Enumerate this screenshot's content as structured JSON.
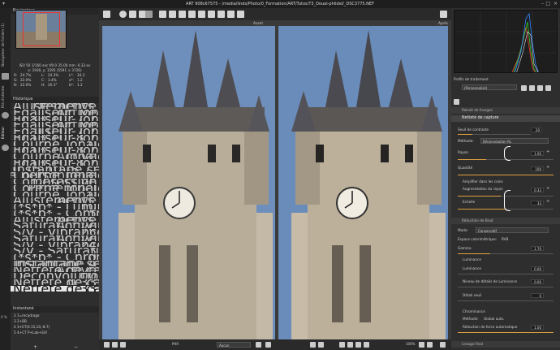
{
  "window": {
    "title": "ART 908c67575 - /media/linds/Photo/0_Formation/ART/Tutos/T3_Douai-phildel/_DSC3775.NEF"
  },
  "left_tabs": [
    "Navigateur de fichiers (1)",
    "File d'attente",
    "Éditeur"
  ],
  "navigator": {
    "title": "Navigateur",
    "info_line1": "ISO 50   1/160 sec  f/9.0  35.00 mm  -0.33 ev",
    "info_line2": "x: 1930, y: 1595  (5591 × 3726)",
    "rgb_rows": [
      [
        "R:",
        "24.7%",
        "L:",
        "24.3%",
        "L*:",
        "34.3"
      ],
      [
        "G:",
        "22.0%",
        "C:",
        "3.4%",
        "a*:",
        "1.2"
      ],
      [
        "B:",
        "22.0%",
        "H:",
        "20.3°",
        "b*:",
        "1.2"
      ]
    ]
  },
  "history": {
    "title": "Historique",
    "rows": [
      [
        "Ajustements (*s*b*",
        "Désactivé"
      ],
      [
        "Égaliseur Tonal",
        "Activé"
      ],
      [
        "Égaliseur Tonal - Ba...",
        "0 33 10 -7 7"
      ],
      [
        "Égaliseur Tonal",
        "Activé"
      ],
      [
        "Égaliseur Tonal - Ba...",
        "0 0 0 -7 7"
      ],
      [
        "Égaliseur Tonal - Ba...",
        "0 13 10 -8 7"
      ],
      [
        "Courbe Tonale - Com...",
        "0"
      ],
      [
        "Égaliseur Tonal - Ba...",
        "0 13 10 -8 7"
      ],
      [
        "Courbe Tonale - Com...",
        "Activé"
      ],
      [
        "Égaliseur Tonal - Ba...",
        "0 13 10 -8 7"
      ],
      [
        "Instantané sélection...",
        "4 3+ET(0.15,10,-8.7)"
      ],
      [
        "Courbe Tonale - Com...",
        "Courbe personnelle"
      ],
      [
        "Compression de la P...",
        "Désactivé"
      ],
      [
        "Courbe Tonale - Mode",
        "Perceptuel"
      ],
      [
        "Courbe Tonale - Com...",
        "0"
      ],
      [
        "Ajustements (*s*b*",
        "Activé"
      ],
      [
        "(*s*b* - Luminosité",
        "10"
      ],
      [
        "(*s*b* - Contraste",
        "15"
      ],
      [
        "Ajustements (*s*b*",
        "Activé"
      ],
      [
        "Saturation/Vibrance",
        "Activé"
      ],
      [
        "S/V - Vibrance",
        "25"
      ],
      [
        "Saturation/Vibrance",
        "Activé"
      ],
      [
        "S/V - Vibrance",
        "24"
      ],
      [
        "S/V - Saturation",
        "3"
      ],
      [
        "(*s*b* - Chromaticité",
        "10"
      ],
      [
        "Instantané sélection...",
        "Instantané 4"
      ],
      [
        "Netteté de capture",
        "Activé"
      ],
      [
        "Déconvolution (RL) -...",
        "1.00"
      ],
      [
        "Netteté de capture -...",
        "0.33"
      ],
      [
        "Netteté de capture -...",
        "33"
      ]
    ],
    "selected_index": 29
  },
  "snapshots": {
    "title": "Instantané",
    "items": [
      "2  1=recadrage",
      "3  2+BB",
      "4  3+ET(0.15,10,-8.7)",
      "5  4+CT P+Lab+S/V"
    ]
  },
  "viewer": {
    "left_label": "Avant",
    "right_label": "Après",
    "bottom_profile": "Aucun",
    "bottom_mode": "PHR",
    "zoom": "100%"
  },
  "right_panel": {
    "profile_title": "Profils de traitement",
    "profile_value": "(Personnalisé)",
    "sections": {
      "noise_prev": "Retrait de franges",
      "capture": "Netteté de capture",
      "noise": "Réduction de Bruit",
      "final": "Lissage final"
    },
    "capture": {
      "contrast_label": "Seuil de contraste",
      "contrast_value": "20",
      "method_label": "Méthode:",
      "method_value": "Déconvolution RL",
      "radius_label": "Rayon",
      "radius_value": "1.00",
      "amount_label": "Quantité",
      "amount_value": "100",
      "corners_label": "Amplifier dans les coins",
      "radius_boost_label": "Augmentation du rayon",
      "radius_boost_value": "0.33",
      "scale_label": "Echelle",
      "scale_value": "33",
      "radius_fill": 0.3,
      "amount_fill": 1.0,
      "radius_boost_fill": 0.45,
      "scale_fill": 0.5
    },
    "noise": {
      "mode_label": "Mode:",
      "mode_value": "Conservatif",
      "color_space_label": "Espace colorimétrique:",
      "color_space_value": "RVB",
      "gamma_label": "Gamma",
      "gamma_value": "1.70",
      "luminance_label": "Luminance",
      "luminance_sub": "Luminance",
      "luminance_value": "0.00",
      "detail_label": "Niveau de détails de Luminance",
      "detail_value": "0.00",
      "threshold_label": "Détail seuil",
      "threshold_value": "0",
      "chroma_label": "Chrominance",
      "chroma_method_label": "Méthode:",
      "chroma_method_value": "Global auto.",
      "chroma_reduce_label": "Réduction de force automatique",
      "chroma_reduce_value": "1.00"
    }
  },
  "status": {
    "left_pct": "0 %"
  }
}
